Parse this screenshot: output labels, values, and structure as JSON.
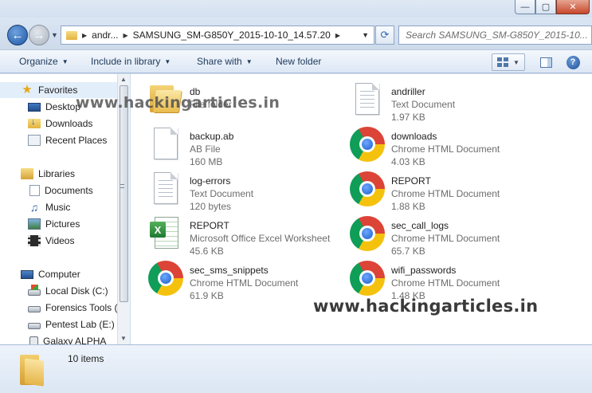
{
  "window": {
    "minimize_glyph": "—",
    "maximize_glyph": "▢",
    "close_glyph": "✕"
  },
  "navigation": {
    "back_glyph": "←",
    "forward_glyph": "→",
    "breadcrumb": [
      "andr...",
      "SAMSUNG_SM-G850Y_2015-10-10_14.57.20"
    ],
    "search_placeholder": "Search SAMSUNG_SM-G850Y_2015-10..."
  },
  "toolbar": {
    "organize": "Organize",
    "include_in_library": "Include in library",
    "share_with": "Share with",
    "new_folder": "New folder",
    "help_glyph": "?"
  },
  "sidebar": {
    "favorites": {
      "label": "Favorites",
      "items": [
        "Desktop",
        "Downloads",
        "Recent Places"
      ]
    },
    "libraries": {
      "label": "Libraries",
      "items": [
        "Documents",
        "Music",
        "Pictures",
        "Videos"
      ]
    },
    "computer": {
      "label": "Computer",
      "items": [
        "Local Disk (C:)",
        "Forensics Tools (",
        "Pentest Lab (E:)",
        "Galaxy ALPHA"
      ]
    }
  },
  "files": [
    {
      "name": "db",
      "type": "File folder",
      "size": "",
      "icon": "folder-icon"
    },
    {
      "name": "andriller",
      "type": "Text Document",
      "size": "1.97 KB",
      "icon": "text-document-icon"
    },
    {
      "name": "backup.ab",
      "type": "AB File",
      "size": "160 MB",
      "icon": "blank-file-icon"
    },
    {
      "name": "downloads",
      "type": "Chrome HTML Document",
      "size": "4.03 KB",
      "icon": "chrome-icon"
    },
    {
      "name": "log-errors",
      "type": "Text Document",
      "size": "120 bytes",
      "icon": "text-document-icon"
    },
    {
      "name": "REPORT",
      "type": "Chrome HTML Document",
      "size": "1.88 KB",
      "icon": "chrome-icon"
    },
    {
      "name": "REPORT",
      "type": "Microsoft Office Excel Worksheet",
      "size": "45.6 KB",
      "icon": "excel-icon"
    },
    {
      "name": "sec_call_logs",
      "type": "Chrome HTML Document",
      "size": "65.7 KB",
      "icon": "chrome-icon"
    },
    {
      "name": "sec_sms_snippets",
      "type": "Chrome HTML Document",
      "size": "61.9 KB",
      "icon": "chrome-icon"
    },
    {
      "name": "wifi_passwords",
      "type": "Chrome HTML Document",
      "size": "1.48 KB",
      "icon": "chrome-icon"
    }
  ],
  "watermark": "www.hackingarticles.in",
  "status": {
    "item_count": "10 items"
  }
}
